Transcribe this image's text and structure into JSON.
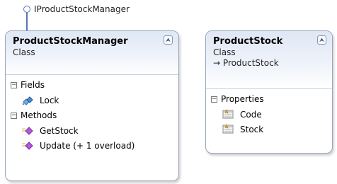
{
  "interface": {
    "name": "IProductStockManager"
  },
  "classes": [
    {
      "name": "ProductStockManager",
      "stereotype": "Class",
      "compartments": [
        {
          "title": "Fields",
          "members": [
            {
              "name": "Lock",
              "icon": "field-icon"
            }
          ]
        },
        {
          "title": "Methods",
          "members": [
            {
              "name": "GetStock",
              "icon": "method-icon"
            },
            {
              "name": "Update (+ 1 overload)",
              "icon": "method-icon"
            }
          ]
        }
      ]
    },
    {
      "name": "ProductStock",
      "stereotype": "Class",
      "base": "→ ProductStock",
      "compartments": [
        {
          "title": "Properties",
          "members": [
            {
              "name": "Code",
              "icon": "property-icon"
            },
            {
              "name": "Stock",
              "icon": "property-icon"
            }
          ]
        }
      ]
    }
  ],
  "symbols": {
    "collapse": "⮝",
    "toggle": "−"
  },
  "colors": {
    "border": "#9aa6bd",
    "header_top": "#dfe7f5",
    "method": "#a64bd1",
    "property": "#d9a227"
  }
}
